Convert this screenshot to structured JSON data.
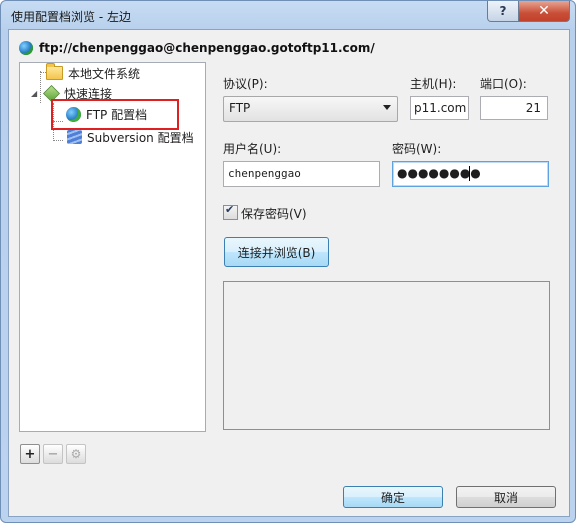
{
  "window": {
    "title": "使用配置档浏览 - 左边",
    "help_label": "?",
    "close_label": "✕"
  },
  "path": "ftp://chenpenggao@chenpenggao.gotoftp11.com/",
  "tree": {
    "items": [
      {
        "label": "本地文件系统",
        "icon": "folder-icon"
      },
      {
        "label": "快速连接",
        "icon": "quick-connect-icon"
      },
      {
        "label": "FTP 配置档",
        "icon": "globe-icon"
      },
      {
        "label": "Subversion 配置档",
        "icon": "subversion-icon"
      }
    ],
    "toolbar": {
      "add": "+",
      "remove": "−",
      "settings": "⚙"
    }
  },
  "form": {
    "protocol_label": "协议(P):",
    "protocol_value": "FTP",
    "host_label": "主机(H):",
    "host_value": "p11.com",
    "port_label": "端口(O):",
    "port_value": "21",
    "username_label": "用户名(U):",
    "username_value": "chenpenggao",
    "password_label": "密码(W):",
    "password_value": "●●●●●●●●",
    "save_password_label": "保存密码(V)",
    "save_password_checked": true,
    "connect_button": "连接并浏览(B)"
  },
  "buttons": {
    "ok": "确定",
    "cancel": "取消"
  }
}
